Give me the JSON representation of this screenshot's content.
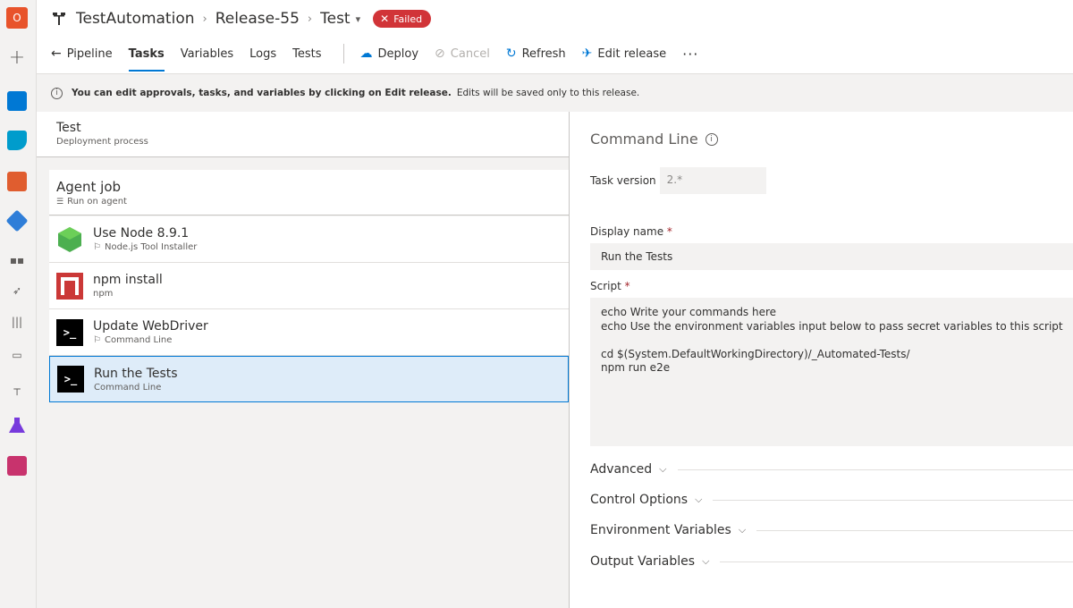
{
  "rail": {
    "org_letter": "O"
  },
  "header": {
    "project": "TestAutomation",
    "release": "Release-55",
    "stage": "Test",
    "status": "Failed"
  },
  "toolbar": {
    "pipeline": "Pipeline",
    "tasks": "Tasks",
    "variables": "Variables",
    "logs": "Logs",
    "tests": "Tests",
    "deploy": "Deploy",
    "cancel": "Cancel",
    "refresh": "Refresh",
    "edit_release": "Edit release",
    "more": "···"
  },
  "info": {
    "bold": "You can edit approvals, tasks, and variables by clicking on Edit release.",
    "rest": "Edits will be saved only to this release."
  },
  "stage": {
    "title": "Test",
    "subtitle": "Deployment process"
  },
  "job": {
    "title": "Agent job",
    "subtitle": "Run on agent"
  },
  "tasks": [
    {
      "name": "Use Node 8.9.1",
      "type": "Node.js Tool Installer",
      "icon": "nodejs-icon"
    },
    {
      "name": "npm install",
      "type": "npm",
      "icon": "npm-icon"
    },
    {
      "name": "Update WebDriver",
      "type": "Command Line",
      "icon": "command-line-icon"
    },
    {
      "name": "Run the Tests",
      "type": "Command Line",
      "icon": "command-line-icon"
    }
  ],
  "detail": {
    "title": "Command Line",
    "task_version_label": "Task version",
    "task_version": "2.*",
    "display_name_label": "Display name",
    "display_name": "Run the Tests",
    "script_label": "Script",
    "script": "echo Write your commands here\necho Use the environment variables input below to pass secret variables to this script\n\ncd $(System.DefaultWorkingDirectory)/_Automated-Tests/\nnpm run e2e",
    "sections": [
      "Advanced",
      "Control Options",
      "Environment Variables",
      "Output Variables"
    ]
  },
  "colors": {
    "accent": "#0078d4",
    "failed": "#d13438",
    "npm": "#cb3837",
    "node": "#4caf50"
  }
}
